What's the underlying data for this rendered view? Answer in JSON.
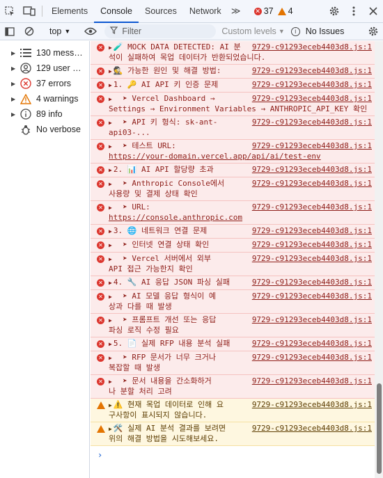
{
  "tabs": [
    {
      "label": "Elements",
      "active": false
    },
    {
      "label": "Console",
      "active": true
    },
    {
      "label": "Sources",
      "active": false
    },
    {
      "label": "Network",
      "active": false
    }
  ],
  "counts": {
    "errors": "37",
    "warnings": "4"
  },
  "toolbar": {
    "context": "top",
    "filter_placeholder": "Filter",
    "levels": "Custom levels",
    "issues": "No Issues"
  },
  "sidebar": {
    "items": [
      {
        "label": "130 mess…",
        "icon": "list-icon"
      },
      {
        "label": "129 user …",
        "icon": "user-icon"
      },
      {
        "label": "37 errors",
        "icon": "error-icon"
      },
      {
        "label": "4 warnings",
        "icon": "warning-icon"
      },
      {
        "label": "89 info",
        "icon": "info-icon"
      },
      {
        "label": "No verbose",
        "icon": "bug-icon"
      }
    ]
  },
  "console": {
    "source": "9729-c91293eceb4403d8.js:1",
    "messages": [
      {
        "level": "error",
        "expandable": false,
        "text": "🧪 MOCK DATA DETECTED: AI 분",
        "cont": "석이 실패하여 목업 데이터가 반환되었습니다."
      },
      {
        "level": "error",
        "expandable": true,
        "text": "🕵 가능한 원인 및 해결 방법:",
        "cont": ""
      },
      {
        "level": "error",
        "expandable": true,
        "text": "1. 🔑 AI API 키 인증 문제",
        "cont": ""
      },
      {
        "level": "error",
        "expandable": true,
        "text": "  ➤ Vercel Dashboard →",
        "cont": "Settings → Environment Variables → ANTHROPIC_API_KEY 확인"
      },
      {
        "level": "error",
        "expandable": true,
        "text": "  ➤ API 키 형식: sk-ant-",
        "cont": "api03-..."
      },
      {
        "level": "error",
        "expandable": true,
        "text": "  ➤ 테스트 URL:",
        "cont": "https://your-domain.vercel.app/api/ai/test-env",
        "link": true
      },
      {
        "level": "error",
        "expandable": true,
        "text": "2. 📊 AI API 할당량 초과",
        "cont": ""
      },
      {
        "level": "error",
        "expandable": true,
        "text": "  ➤ Anthropic Console에서",
        "cont": "사용량 및 결제 상태 확인"
      },
      {
        "level": "error",
        "expandable": true,
        "text": "  ➤ URL:",
        "cont": "https://console.anthropic.com",
        "link": true
      },
      {
        "level": "error",
        "expandable": true,
        "text": "3. 🌐 네트워크 연결 문제",
        "cont": ""
      },
      {
        "level": "error",
        "expandable": true,
        "text": "  ➤ 인터넷 연결 상태 확인",
        "cont": ""
      },
      {
        "level": "error",
        "expandable": true,
        "text": "  ➤ Vercel 서버에서 외부",
        "cont": "API 접근 가능한지 확인"
      },
      {
        "level": "error",
        "expandable": true,
        "text": "4. 🔧 AI 응답 JSON 파싱 실패",
        "cont": ""
      },
      {
        "level": "error",
        "expandable": true,
        "text": "  ➤ AI 모델 응답 형식이 예",
        "cont": "상과 다를 때 발생"
      },
      {
        "level": "error",
        "expandable": true,
        "text": "  ➤ 프롬프트 개선 또는 응답",
        "cont": "파싱 로직 수정 필요"
      },
      {
        "level": "error",
        "expandable": true,
        "text": "5. 📄 실제 RFP 내용 분석 실패",
        "cont": ""
      },
      {
        "level": "error",
        "expandable": true,
        "text": "  ➤ RFP 문서가 너무 크거나",
        "cont": "복잡할 때 발생"
      },
      {
        "level": "error",
        "expandable": true,
        "text": "  ➤ 문서 내용을 간소화하거",
        "cont": "나 분할 처리 고려"
      },
      {
        "level": "warn",
        "expandable": true,
        "text": "⚠️ 현재 목업 데이터로 인해 요",
        "cont": "구사항이 표시되지 않습니다."
      },
      {
        "level": "warn",
        "expandable": true,
        "text": "🛠️ 실제 AI 분석 결과를 보려면",
        "cont": "위의 해결 방법을 시도해보세요."
      }
    ]
  },
  "colors": {
    "accent": "#0b57d0",
    "error": "#dc362e",
    "warning": "#e37400"
  }
}
